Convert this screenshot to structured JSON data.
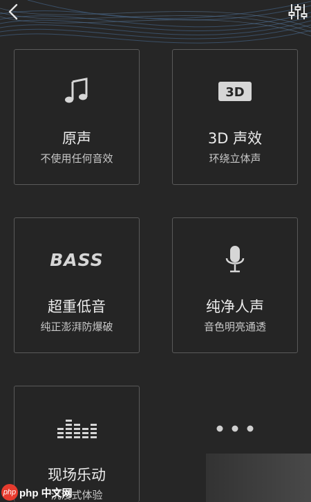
{
  "header": {
    "back_icon": "chevron-left-icon",
    "equalizer_icon": "equalizer-sliders-icon"
  },
  "effects": [
    {
      "title": "原声",
      "subtitle": "不使用任何音效",
      "icon": "music-note-icon"
    },
    {
      "title": "3D 声效",
      "subtitle": "环绕立体声",
      "icon": "3d-badge-icon",
      "badge_text": "3D"
    },
    {
      "title": "超重低音",
      "subtitle": "纯正澎湃防爆破",
      "icon": "bass-text-icon",
      "badge_text": "BASS"
    },
    {
      "title": "纯净人声",
      "subtitle": "音色明亮通透",
      "icon": "microphone-icon"
    },
    {
      "title": "现场乐动",
      "subtitle": "沉浸式体验",
      "icon": "spectrum-bars-icon"
    }
  ],
  "more": {
    "icon": "more-dots-icon"
  },
  "watermark": {
    "text": "php 中文网"
  },
  "colors": {
    "background": "#262626",
    "card_border": "#5a5a5a",
    "text": "#ececec"
  }
}
